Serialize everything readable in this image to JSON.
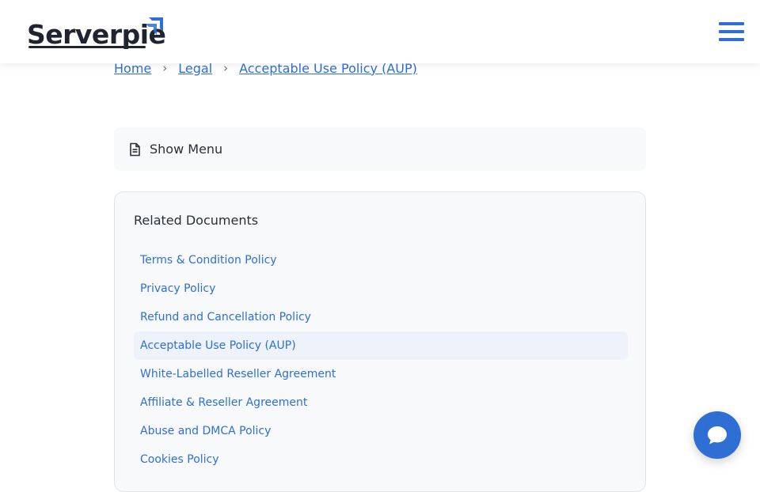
{
  "brand": {
    "name": "Serverpie",
    "icon": "arrow-up-right-icon",
    "text_color": "#1f2430",
    "accent_color": "#2f6fd3"
  },
  "header": {
    "menu_icon": "hamburger-menu-icon"
  },
  "breadcrumb": {
    "items": [
      {
        "label": "Home"
      },
      {
        "label": "Legal"
      },
      {
        "label": "Acceptable Use Policy (AUP)"
      }
    ],
    "separator": "›"
  },
  "show_menu": {
    "icon": "document-icon",
    "label": "Show Menu"
  },
  "related": {
    "title": "Related Documents",
    "items": [
      {
        "label": "Terms & Condition Policy",
        "active": false
      },
      {
        "label": "Privacy Policy",
        "active": false
      },
      {
        "label": "Refund and Cancellation Policy",
        "active": false
      },
      {
        "label": "Acceptable Use Policy (AUP)",
        "active": true
      },
      {
        "label": "White-Labelled Reseller Agreement",
        "active": false
      },
      {
        "label": "Affiliate & Reseller Agreement",
        "active": false
      },
      {
        "label": "Abuse and DMCA Policy",
        "active": false
      },
      {
        "label": "Cookies Policy",
        "active": false
      }
    ]
  },
  "chat": {
    "icon": "chat-bubble-icon",
    "color": "#2f6fd3"
  }
}
